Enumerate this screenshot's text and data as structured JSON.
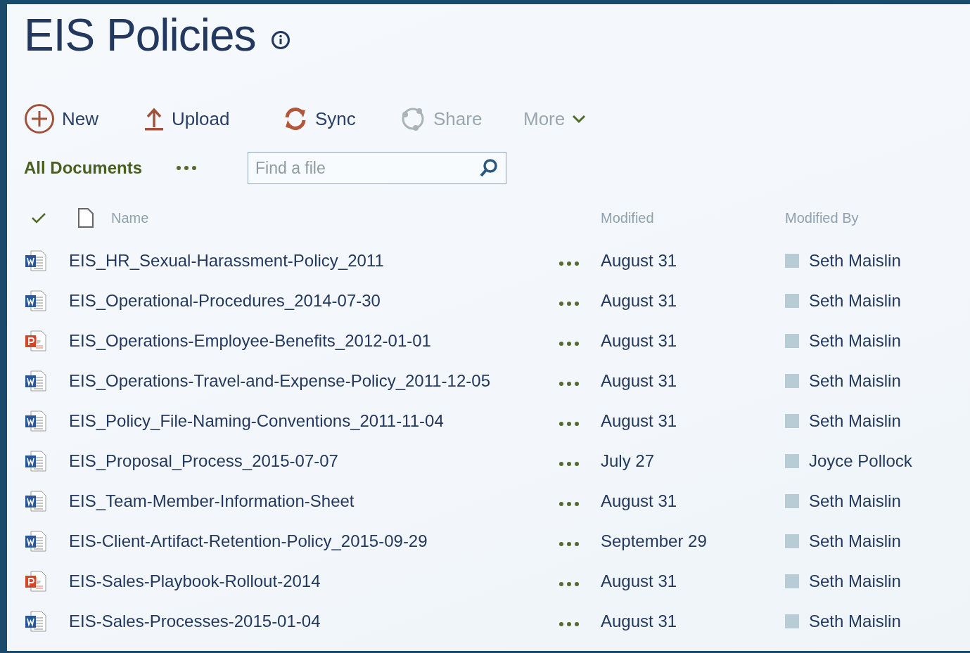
{
  "title": "EIS Policies",
  "toolbar": [
    {
      "kind": "new",
      "label": "New",
      "disabled": false
    },
    {
      "kind": "upload",
      "label": "Upload",
      "disabled": false
    },
    {
      "kind": "sync",
      "label": "Sync",
      "disabled": false
    },
    {
      "kind": "share",
      "label": "Share",
      "disabled": true
    },
    {
      "kind": "more",
      "label": "More",
      "disabled": true
    }
  ],
  "view": {
    "label": "All Documents"
  },
  "search": {
    "placeholder": "Find a file"
  },
  "table": {
    "columns": [
      "Name",
      "Modified",
      "Modified By"
    ],
    "rows": [
      {
        "kind": "word",
        "name": "EIS_HR_Sexual-Harassment-Policy_2011",
        "modified": "August 31",
        "modified_by": "Seth Maislin"
      },
      {
        "kind": "word",
        "name": "EIS_Operational-Procedures_2014-07-30",
        "modified": "August 31",
        "modified_by": "Seth Maislin"
      },
      {
        "kind": "powerpoint",
        "name": "EIS_Operations-Employee-Benefits_2012-01-01",
        "modified": "August 31",
        "modified_by": "Seth Maislin"
      },
      {
        "kind": "word",
        "name": "EIS_Operations-Travel-and-Expense-Policy_2011-12-05",
        "modified": "August 31",
        "modified_by": "Seth Maislin"
      },
      {
        "kind": "word",
        "name": "EIS_Policy_File-Naming-Conventions_2011-11-04",
        "modified": "August 31",
        "modified_by": "Seth Maislin"
      },
      {
        "kind": "word",
        "name": "EIS_Proposal_Process_2015-07-07",
        "modified": "July 27",
        "modified_by": "Joyce Pollock"
      },
      {
        "kind": "word",
        "name": "EIS_Team-Member-Information-Sheet",
        "modified": "August 31",
        "modified_by": "Seth Maislin"
      },
      {
        "kind": "word",
        "name": "EIS-Client-Artifact-Retention-Policy_2015-09-29",
        "modified": "September 29",
        "modified_by": "Seth Maislin"
      },
      {
        "kind": "powerpoint",
        "name": "EIS-Sales-Playbook-Rollout-2014",
        "modified": "August 31",
        "modified_by": "Seth Maislin"
      },
      {
        "kind": "word",
        "name": "EIS-Sales-Processes-2015-01-04",
        "modified": "August 31",
        "modified_by": "Seth Maislin"
      }
    ]
  }
}
